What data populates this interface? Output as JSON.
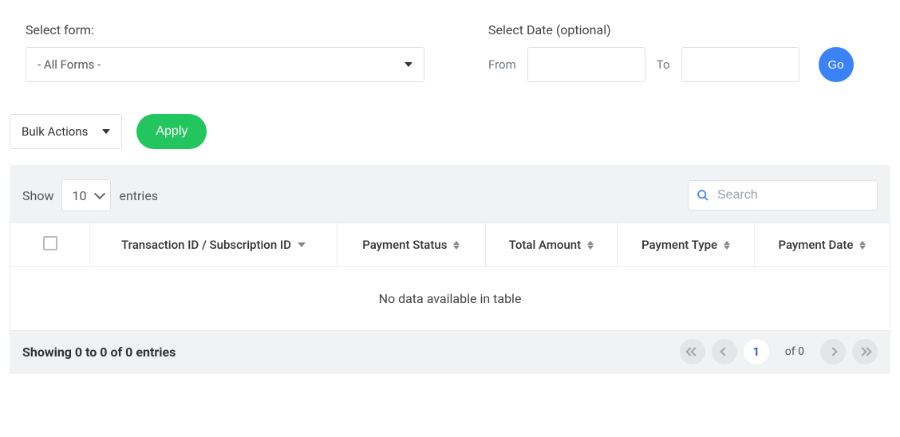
{
  "filters": {
    "form_label": "Select form:",
    "form_value": "- All Forms -",
    "date_label": "Select Date (optional)",
    "from_label": "From",
    "to_label": "To",
    "from_value": "",
    "to_value": "",
    "go_label": "Go"
  },
  "bulk": {
    "select_label": "Bulk Actions",
    "apply_label": "Apply"
  },
  "table": {
    "show_label": "Show",
    "entries_label": "entries",
    "page_size": "10",
    "search_placeholder": "Search",
    "columns": {
      "transaction_id": "Transaction ID / Subscription ID",
      "payment_status": "Payment Status",
      "total_amount": "Total Amount",
      "payment_type": "Payment Type",
      "payment_date": "Payment Date"
    },
    "no_data_text": "No data available in table",
    "showing_text": "Showing 0 to 0 of 0 entries",
    "current_page": "1",
    "of_total": "of 0"
  }
}
